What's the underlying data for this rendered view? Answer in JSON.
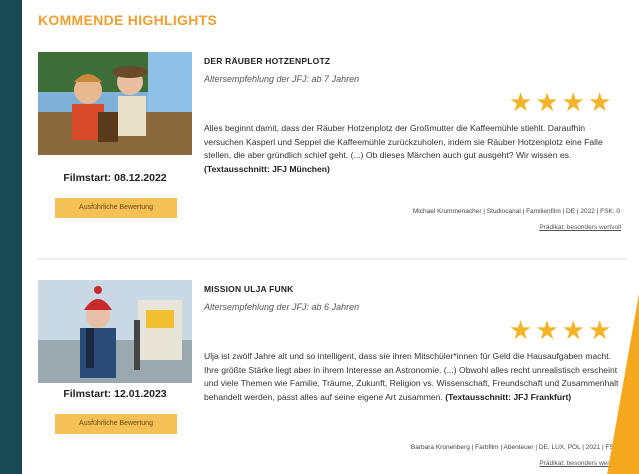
{
  "section": {
    "title": "KOMMENDE HIGHLIGHTS"
  },
  "colors": {
    "accent": "#f0a030",
    "star": "#f4b42a",
    "button": "#f5c056",
    "background": "#1b4a57"
  },
  "films": [
    {
      "title": "DER RÄUBER HOTZENPLOTZ",
      "age": "Altersempfehlung der JFJ: ab 7 Jahren",
      "rating": 4,
      "filmstart": "Filmstart: 08.12.2022",
      "button": "Ausführliche Bewertung",
      "desc": "Alles beginnt damit, dass der Räuber Hotzenplotz der Großmutter die Kaffeemühle stiehlt. Daraufhin versuchen Kasperl und Seppel die Kaffeemühle zurückzuholen, indem sie Räuber Hotzenplotz eine Falle stellen, die aber gründlich schief geht. (...) Ob dieses Märchen auch gut ausgeht? Wir wissen es.",
      "source": "(Textausschnitt: JFJ München)",
      "meta": "Michael Krummenacher | Studiocanal | Familienfilm | DE | 2022 | FSK: 0",
      "pradikat": "Prädikat: besonders wertvoll",
      "poster_icon": "film-poster-image"
    },
    {
      "title": "MISSION ULJA FUNK",
      "age": "Altersempfehlung der JFJ: ab 6 Jahren",
      "rating": 4,
      "filmstart": "Filmstart: 12.01.2023",
      "button": "Ausführliche Bewertung",
      "desc": "Ulja ist zwölf Jahre alt und so intelligent, dass sie ihren Mitschüler*innen für Geld die Hausaufgaben macht. Ihre größte Stärke liegt aber in ihrem Interesse an Astronomie. (...) Obwohl alles recht unrealistisch erscheint und viele Themen wie Familie, Träume, Zukunft, Religion vs. Wissenschaft, Freundschaft und Zusammenhalt behandelt werden, passt alles auf seine eigene Art zusammen.",
      "source": "(Textausschnitt: JFJ Frankfurt)",
      "meta": "Barbara Kronenberg | Farbfilm | Abenteuer | DE, LUX, POL | 2021 | FSK:",
      "pradikat": "Prädikat: besonders wertvoll",
      "poster_icon": "film-poster-image"
    }
  ]
}
